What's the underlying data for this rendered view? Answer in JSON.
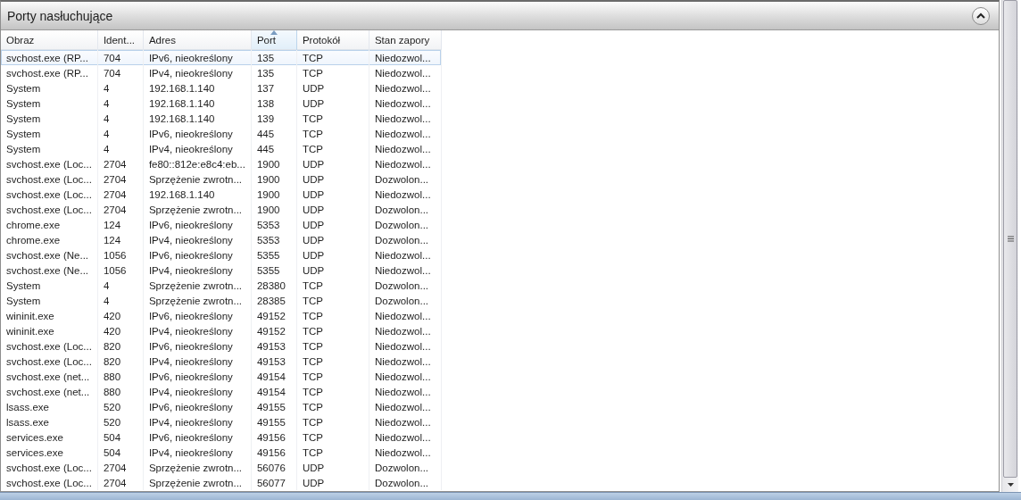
{
  "panel": {
    "title": "Porty nasłuchujące",
    "expanded": true
  },
  "table": {
    "columns": [
      {
        "label": "Obraz",
        "sorted": false
      },
      {
        "label": "Ident...",
        "sorted": false
      },
      {
        "label": "Adres",
        "sorted": false
      },
      {
        "label": "Port",
        "sorted": true
      },
      {
        "label": "Protokół",
        "sorted": false
      },
      {
        "label": "Stan zapory",
        "sorted": false
      }
    ],
    "rows": [
      {
        "selected": true,
        "cells": [
          "svchost.exe (RP...",
          "704",
          "IPv6, nieokreślony",
          "135",
          "TCP",
          "Niedozwol..."
        ]
      },
      {
        "selected": false,
        "cells": [
          "svchost.exe (RP...",
          "704",
          "IPv4, nieokreślony",
          "135",
          "TCP",
          "Niedozwol..."
        ]
      },
      {
        "selected": false,
        "cells": [
          "System",
          "4",
          "192.168.1.140",
          "137",
          "UDP",
          "Niedozwol..."
        ]
      },
      {
        "selected": false,
        "cells": [
          "System",
          "4",
          "192.168.1.140",
          "138",
          "UDP",
          "Niedozwol..."
        ]
      },
      {
        "selected": false,
        "cells": [
          "System",
          "4",
          "192.168.1.140",
          "139",
          "TCP",
          "Niedozwol..."
        ]
      },
      {
        "selected": false,
        "cells": [
          "System",
          "4",
          "IPv6, nieokreślony",
          "445",
          "TCP",
          "Niedozwol..."
        ]
      },
      {
        "selected": false,
        "cells": [
          "System",
          "4",
          "IPv4, nieokreślony",
          "445",
          "TCP",
          "Niedozwol..."
        ]
      },
      {
        "selected": false,
        "cells": [
          "svchost.exe (Loc...",
          "2704",
          "fe80::812e:e8c4:eb...",
          "1900",
          "UDP",
          "Niedozwol..."
        ]
      },
      {
        "selected": false,
        "cells": [
          "svchost.exe (Loc...",
          "2704",
          "Sprzężenie zwrotn...",
          "1900",
          "UDP",
          "Dozwolon..."
        ]
      },
      {
        "selected": false,
        "cells": [
          "svchost.exe (Loc...",
          "2704",
          "192.168.1.140",
          "1900",
          "UDP",
          "Niedozwol..."
        ]
      },
      {
        "selected": false,
        "cells": [
          "svchost.exe (Loc...",
          "2704",
          "Sprzężenie zwrotn...",
          "1900",
          "UDP",
          "Dozwolon..."
        ]
      },
      {
        "selected": false,
        "cells": [
          "chrome.exe",
          "124",
          "IPv6, nieokreślony",
          "5353",
          "UDP",
          "Dozwolon..."
        ]
      },
      {
        "selected": false,
        "cells": [
          "chrome.exe",
          "124",
          "IPv4, nieokreślony",
          "5353",
          "UDP",
          "Dozwolon..."
        ]
      },
      {
        "selected": false,
        "cells": [
          "svchost.exe (Ne...",
          "1056",
          "IPv6, nieokreślony",
          "5355",
          "UDP",
          "Niedozwol..."
        ]
      },
      {
        "selected": false,
        "cells": [
          "svchost.exe (Ne...",
          "1056",
          "IPv4, nieokreślony",
          "5355",
          "UDP",
          "Niedozwol..."
        ]
      },
      {
        "selected": false,
        "cells": [
          "System",
          "4",
          "Sprzężenie zwrotn...",
          "28380",
          "TCP",
          "Dozwolon..."
        ]
      },
      {
        "selected": false,
        "cells": [
          "System",
          "4",
          "Sprzężenie zwrotn...",
          "28385",
          "TCP",
          "Dozwolon..."
        ]
      },
      {
        "selected": false,
        "cells": [
          "wininit.exe",
          "420",
          "IPv6, nieokreślony",
          "49152",
          "TCP",
          "Niedozwol..."
        ]
      },
      {
        "selected": false,
        "cells": [
          "wininit.exe",
          "420",
          "IPv4, nieokreślony",
          "49152",
          "TCP",
          "Niedozwol..."
        ]
      },
      {
        "selected": false,
        "cells": [
          "svchost.exe (Loc...",
          "820",
          "IPv6, nieokreślony",
          "49153",
          "TCP",
          "Niedozwol..."
        ]
      },
      {
        "selected": false,
        "cells": [
          "svchost.exe (Loc...",
          "820",
          "IPv4, nieokreślony",
          "49153",
          "TCP",
          "Niedozwol..."
        ]
      },
      {
        "selected": false,
        "cells": [
          "svchost.exe (net...",
          "880",
          "IPv6, nieokreślony",
          "49154",
          "TCP",
          "Niedozwol..."
        ]
      },
      {
        "selected": false,
        "cells": [
          "svchost.exe (net...",
          "880",
          "IPv4, nieokreślony",
          "49154",
          "TCP",
          "Niedozwol..."
        ]
      },
      {
        "selected": false,
        "cells": [
          "lsass.exe",
          "520",
          "IPv6, nieokreślony",
          "49155",
          "TCP",
          "Niedozwol..."
        ]
      },
      {
        "selected": false,
        "cells": [
          "lsass.exe",
          "520",
          "IPv4, nieokreślony",
          "49155",
          "TCP",
          "Niedozwol..."
        ]
      },
      {
        "selected": false,
        "cells": [
          "services.exe",
          "504",
          "IPv6, nieokreślony",
          "49156",
          "TCP",
          "Niedozwol..."
        ]
      },
      {
        "selected": false,
        "cells": [
          "services.exe",
          "504",
          "IPv4, nieokreślony",
          "49156",
          "TCP",
          "Niedozwol..."
        ]
      },
      {
        "selected": false,
        "cells": [
          "svchost.exe (Loc...",
          "2704",
          "Sprzężenie zwrotn...",
          "56076",
          "UDP",
          "Dozwolon..."
        ]
      },
      {
        "selected": false,
        "cells": [
          "svchost.exe (Loc...",
          "2704",
          "Sprzężenie zwrotn...",
          "56077",
          "UDP",
          "Dozwolon..."
        ]
      }
    ]
  }
}
